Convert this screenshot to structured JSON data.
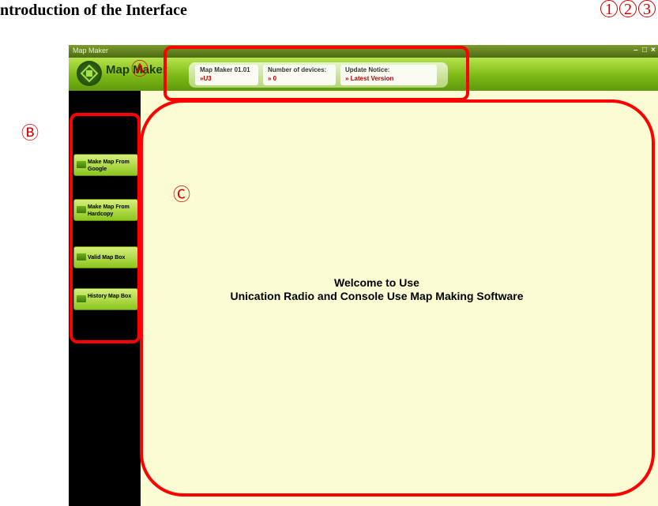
{
  "doc": {
    "heading": "ntroduction of the Interface"
  },
  "callout_numbers": [
    "1",
    "2",
    "3"
  ],
  "window": {
    "title": "Map Maker",
    "controls": {
      "minimize": "–",
      "restore": "□",
      "close": "×"
    }
  },
  "header": {
    "logo_text": "Map Maker",
    "info": [
      {
        "label": "Map Maker 01.01",
        "value": "»U3"
      },
      {
        "label": "Number of devices:",
        "value": "» 0"
      },
      {
        "label": "Update Notice:",
        "value": "» Latest Version"
      }
    ]
  },
  "sidebar": {
    "items": [
      {
        "label": "Make Map From Google"
      },
      {
        "label": "Make Map From Hardcopy"
      },
      {
        "label": "Valid Map Box"
      },
      {
        "label": "History Map Box"
      }
    ]
  },
  "main": {
    "welcome_line1": "Welcome to Use",
    "welcome_line2": "Unication Radio and Console Use Map Making Software"
  },
  "annotations": {
    "a": "Ⓐ",
    "b": "Ⓑ",
    "c": "Ⓒ"
  },
  "colors": {
    "annotation_red": "#ff0000",
    "header_green": "#7dba16",
    "content_bg": "#fbfcd3"
  }
}
